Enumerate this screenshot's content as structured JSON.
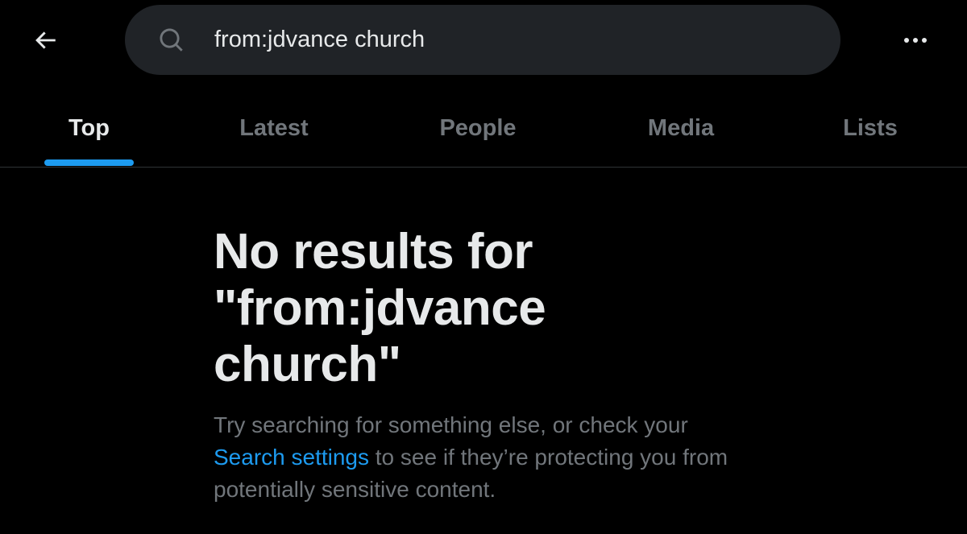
{
  "search": {
    "query": "from:jdvance church"
  },
  "tabs": [
    {
      "label": "Top",
      "active": true
    },
    {
      "label": "Latest",
      "active": false
    },
    {
      "label": "People",
      "active": false
    },
    {
      "label": "Media",
      "active": false
    },
    {
      "label": "Lists",
      "active": false
    }
  ],
  "empty_state": {
    "title_line1": "No results for",
    "title_line2": "\"from:jdvance",
    "title_line3": "church\"",
    "body_prefix": "Try searching for something else, or check your",
    "link_text": "Search settings",
    "body_suffix": " to see if they’re protecting you from potentially sensitive content."
  },
  "icons": {
    "back": "arrow-left-icon",
    "search": "search-icon",
    "more": "more-horizontal-icon"
  },
  "colors": {
    "background": "#000000",
    "search_bg": "#202327",
    "text_primary": "#e7e9ea",
    "text_secondary": "#71767b",
    "accent": "#1d9bf0",
    "divider": "#2f3336"
  }
}
